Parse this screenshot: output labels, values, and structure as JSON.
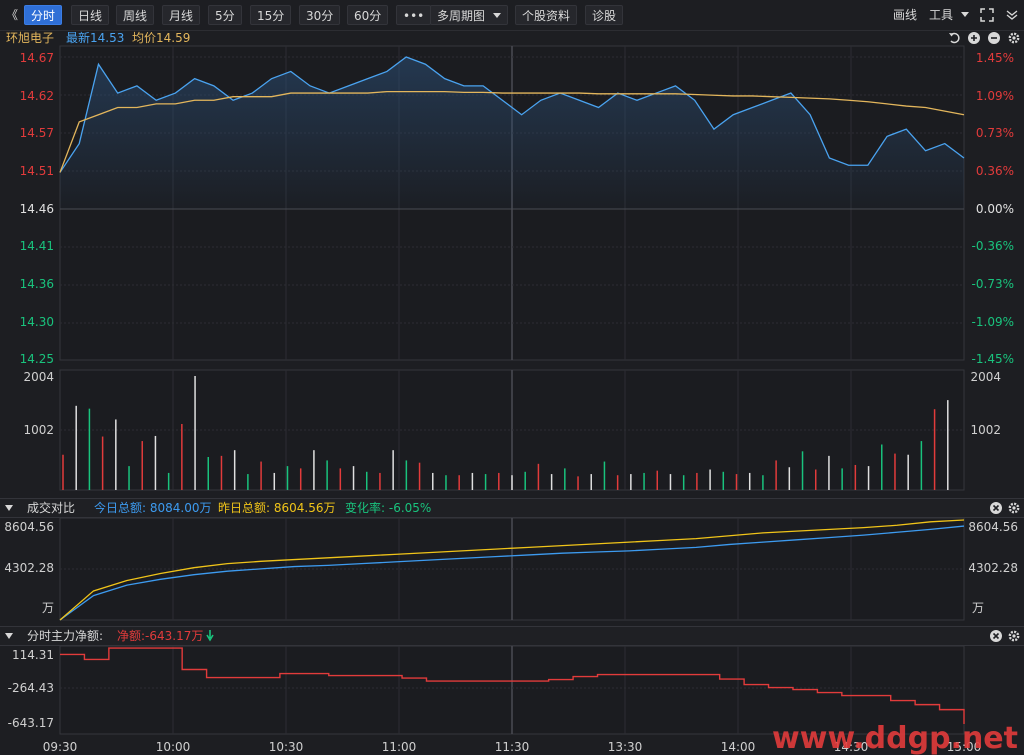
{
  "toolbar": {
    "collapse_label": "《",
    "tabs": [
      {
        "label": "分时",
        "active": true
      },
      {
        "label": "日线"
      },
      {
        "label": "周线"
      },
      {
        "label": "月线"
      },
      {
        "label": "5分"
      },
      {
        "label": "15分"
      },
      {
        "label": "30分"
      },
      {
        "label": "60分"
      }
    ],
    "more_label": "•••",
    "multi_period_label": "多周期图",
    "stock_info_label": "个股资料",
    "diagnose_label": "诊股",
    "draw_label": "画线",
    "tools_label": "工具"
  },
  "quote": {
    "name": "环旭电子",
    "latest_label": "最新14.53",
    "avg_label": "均价14.59"
  },
  "price_axis": {
    "left": [
      "14.67",
      "14.62",
      "14.57",
      "14.51",
      "14.46",
      "14.41",
      "14.36",
      "14.30",
      "14.25"
    ],
    "right": [
      "1.45%",
      "1.09%",
      "0.73%",
      "0.36%",
      "0.00%",
      "-0.36%",
      "-0.73%",
      "-1.09%",
      "-1.45%"
    ]
  },
  "volume_axis": {
    "top": "2004",
    "mid": "1002"
  },
  "turnover_panel": {
    "title": "成交对比",
    "today_label": "今日总额: 8084.00万",
    "yesterday_label": "昨日总额: 8604.56万",
    "change_label": "变化率: -6.05%",
    "axis": [
      "8604.56",
      "4302.28",
      "万"
    ]
  },
  "netflow_panel": {
    "title": "分时主力净额:",
    "net_label": "净额:-643.17万",
    "axis": [
      "114.31",
      "-264.43",
      "-643.17"
    ]
  },
  "time_axis": [
    "09:30",
    "10:00",
    "10:30",
    "11:00",
    "11:30",
    "13:30",
    "14:00",
    "14:30",
    "15:00"
  ],
  "watermark": "www.ddgp.net",
  "colors": {
    "price_line": "#4aa3f0",
    "avg_line": "#e3b65c",
    "up": "#e23b3b",
    "down": "#19c37d",
    "neutral": "#e0e0e0",
    "accent": "#2f6fd6",
    "today_line": "#3d9bf0",
    "yesterday_line": "#f0c419",
    "netflow_line": "#e23b3b"
  },
  "chart_data": [
    {
      "type": "line",
      "series": [
        {
          "name": "最新",
          "values": [
            14.51,
            14.55,
            14.66,
            14.62,
            14.63,
            14.61,
            14.62,
            14.64,
            14.63,
            14.61,
            14.62,
            14.64,
            14.65,
            14.63,
            14.62,
            14.63,
            14.64,
            14.65,
            14.67,
            14.66,
            14.64,
            14.63,
            14.63,
            14.61,
            14.59,
            14.61,
            14.62,
            14.61,
            14.6,
            14.62,
            14.61,
            14.62,
            14.63,
            14.61,
            14.57,
            14.59,
            14.6,
            14.61,
            14.62,
            14.59,
            14.53,
            14.52,
            14.52,
            14.56,
            14.57,
            14.54,
            14.55,
            14.53
          ]
        },
        {
          "name": "均价",
          "values": [
            14.51,
            14.58,
            14.59,
            14.6,
            14.6,
            14.605,
            14.605,
            14.61,
            14.61,
            14.615,
            14.615,
            14.615,
            14.62,
            14.62,
            14.62,
            14.62,
            14.62,
            14.622,
            14.622,
            14.622,
            14.622,
            14.621,
            14.621,
            14.62,
            14.62,
            14.62,
            14.62,
            14.62,
            14.619,
            14.619,
            14.619,
            14.619,
            14.619,
            14.618,
            14.617,
            14.616,
            14.616,
            14.615,
            14.614,
            14.613,
            14.612,
            14.61,
            14.608,
            14.605,
            14.602,
            14.6,
            14.595,
            14.59
          ]
        }
      ],
      "ylim": [
        14.25,
        14.67
      ]
    },
    {
      "type": "bar",
      "values": [
        620,
        1480,
        1430,
        940,
        1240,
        420,
        860,
        950,
        300,
        1160,
        2004,
        580,
        600,
        700,
        280,
        500,
        300,
        420,
        380,
        700,
        520,
        380,
        420,
        320,
        300,
        700,
        520,
        480,
        300,
        260,
        260,
        300,
        280,
        300,
        260,
        320,
        460,
        280,
        380,
        240,
        280,
        500,
        260,
        280,
        300,
        340,
        280,
        260,
        300,
        360,
        320,
        280,
        300,
        260,
        520,
        400,
        680,
        360,
        600,
        380,
        440,
        420,
        800,
        640,
        620,
        860,
        1420,
        1580
      ],
      "ylim": [
        0,
        2004
      ]
    },
    {
      "type": "line",
      "series": [
        {
          "name": "今日总额",
          "values": [
            0,
            2100,
            3000,
            3500,
            3900,
            4200,
            4400,
            4600,
            4700,
            4850,
            5000,
            5150,
            5300,
            5450,
            5600,
            5750,
            5850,
            5950,
            6100,
            6250,
            6500,
            6700,
            6900,
            7100,
            7300,
            7550,
            7800,
            8084
          ]
        },
        {
          "name": "昨日总额",
          "values": [
            0,
            2500,
            3400,
            4000,
            4500,
            4850,
            5050,
            5200,
            5350,
            5500,
            5650,
            5800,
            5950,
            6100,
            6250,
            6400,
            6550,
            6700,
            6850,
            7000,
            7250,
            7500,
            7650,
            7800,
            7950,
            8150,
            8450,
            8604.56
          ]
        }
      ],
      "ylim": [
        0,
        8604.56
      ]
    },
    {
      "type": "line",
      "series": [
        {
          "values": [
            50,
            0,
            114,
            114,
            114,
            -100,
            -180,
            -180,
            -180,
            -140,
            -140,
            -160,
            -160,
            -160,
            -185,
            -215,
            -215,
            -215,
            -215,
            -215,
            -200,
            -170,
            -150,
            -150,
            -150,
            -150,
            -150,
            -195,
            -250,
            -280,
            -300,
            -330,
            -360,
            -360,
            -410,
            -450,
            -500,
            -643
          ]
        }
      ],
      "ylim": [
        -643.17,
        114.31
      ]
    }
  ]
}
